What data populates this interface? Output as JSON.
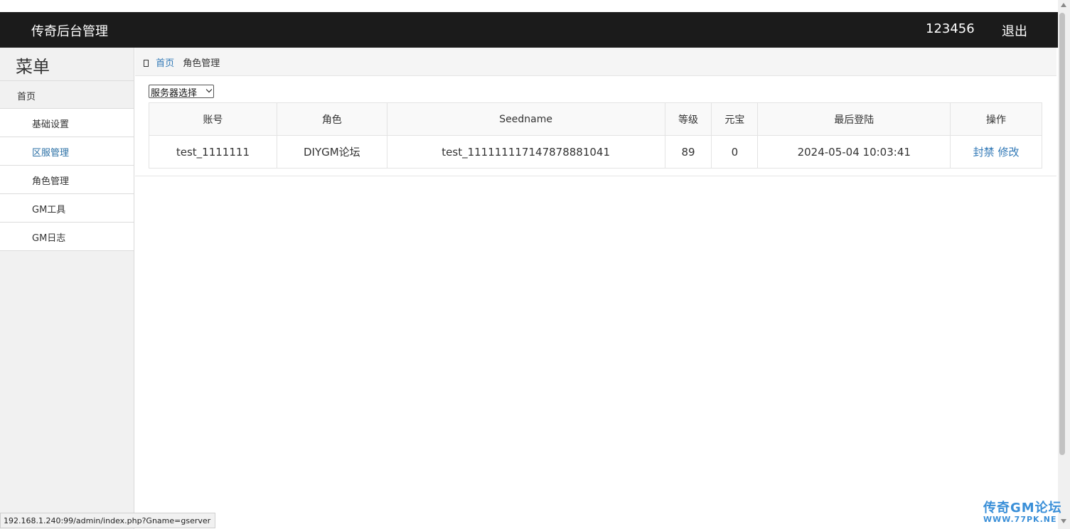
{
  "header": {
    "brand": "传奇后台管理",
    "user": "123456",
    "logout": "退出"
  },
  "sidebar": {
    "menu_title": "菜单",
    "home": "首页",
    "items": [
      {
        "label": "基础设置"
      },
      {
        "label": "区服管理",
        "active": true
      },
      {
        "label": "角色管理"
      },
      {
        "label": "GM工具"
      },
      {
        "label": "GM日志"
      }
    ]
  },
  "breadcrumb": {
    "home": "首页",
    "current": "角色管理"
  },
  "server_select": {
    "selected": "服务器选择"
  },
  "table": {
    "headers": [
      "账号",
      "角色",
      "Seedname",
      "等级",
      "元宝",
      "最后登陆",
      "操作"
    ],
    "rows": [
      {
        "account": "test_1111111",
        "role": "DIYGM论坛",
        "seedname": "test_111111117147878881041",
        "level": "89",
        "yuanbao": "0",
        "last_login": "2024-05-04 10:03:41",
        "actions": [
          "封禁",
          "修改"
        ]
      }
    ]
  },
  "status_url": "192.168.1.240:99/admin/index.php?Gname=gserver",
  "watermark": {
    "line1": "传奇GM论坛",
    "line2": "WWW.77PK.NE"
  },
  "colors": {
    "header_bg": "#1b1b1b",
    "link": "#337ab7",
    "active_menu": "#2a6fa5"
  }
}
